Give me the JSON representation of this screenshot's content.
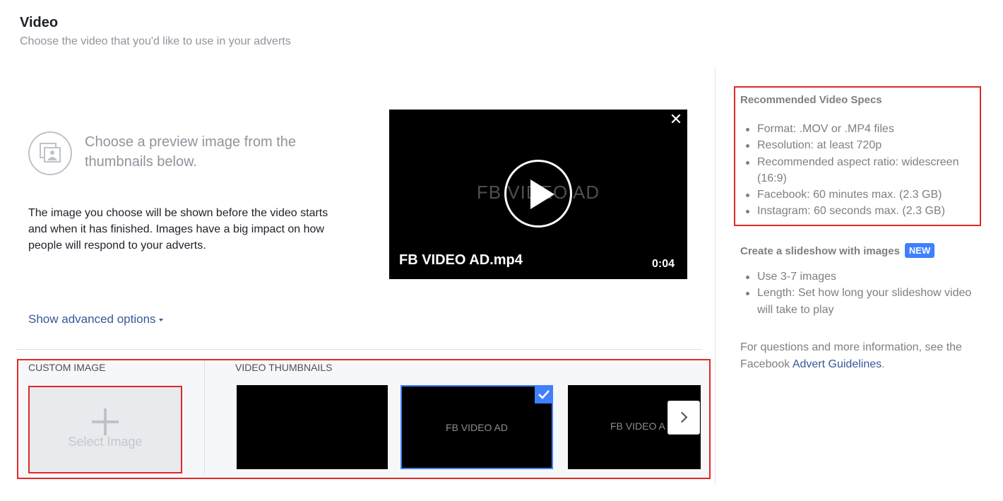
{
  "header": {
    "title": "Video",
    "subtitle": "Choose the video that you'd like to use in your adverts"
  },
  "preview": {
    "icon": "image-gallery-icon",
    "prompt": "Choose a preview image from the thumbnails below.",
    "description": "The image you choose will be shown before the video starts and when it has finished. Images have a big impact on how people will respond to your adverts.",
    "advanced_link": "Show advanced options"
  },
  "player": {
    "watermark": "FB VIDEO AD",
    "filename": "FB VIDEO AD.mp4",
    "duration": "0:04",
    "close_icon": "close-icon",
    "play_icon": "play-icon"
  },
  "thumbnails": {
    "custom_label": "CUSTOM IMAGE",
    "select_label": "Select Image",
    "video_label": "VIDEO THUMBNAILS",
    "items": [
      {
        "text": ""
      },
      {
        "text": "FB VIDEO AD",
        "selected": true
      },
      {
        "text": "FB VIDEO A"
      }
    ],
    "next_icon": "chevron-right-icon"
  },
  "specs": {
    "title": "Recommended Video Specs",
    "items": [
      "Format: .MOV or .MP4 files",
      "Resolution: at least 720p",
      "Recommended aspect ratio: widescreen (16:9)",
      "Facebook: 60 minutes max. (2.3 GB)",
      "Instagram: 60 seconds max. (2.3 GB)"
    ]
  },
  "slideshow": {
    "title": "Create a slideshow with images",
    "badge": "NEW",
    "items": [
      "Use 3-7 images",
      "Length: Set how long your slideshow video will take to play"
    ]
  },
  "footer": {
    "text": "For questions and more information, see the Facebook",
    "link": "Advert Guidelines",
    "end": "."
  },
  "colors": {
    "accent": "#4080ff",
    "link": "#365899",
    "highlight": "#e0292a"
  }
}
